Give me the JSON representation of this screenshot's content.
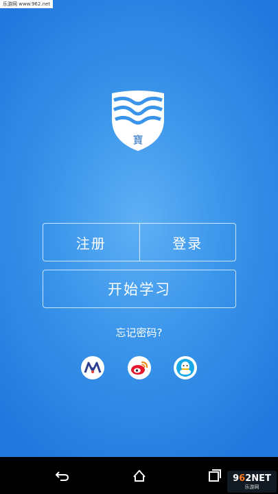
{
  "watermark_top": "乐游网 www.962.net",
  "logo": {
    "icon": "shield-logo-icon",
    "char": "寶"
  },
  "buttons": {
    "register": "注册",
    "login": "登录",
    "start": "开始学习"
  },
  "forgot_password": "忘记密码?",
  "social": [
    {
      "name": "weixin-like-icon"
    },
    {
      "name": "weibo-icon"
    },
    {
      "name": "qq-icon"
    }
  ],
  "navbar": {
    "back": "back-icon",
    "home": "home-icon",
    "recent": "recent-apps-icon"
  },
  "watermark_br": {
    "main_prefix": "9",
    "main_highlight": "6",
    "main_suffix": "2NET",
    "sub": "乐游网"
  },
  "colors": {
    "accent": "#2d8ae6",
    "white": "#ffffff",
    "navbar": "#000000"
  }
}
